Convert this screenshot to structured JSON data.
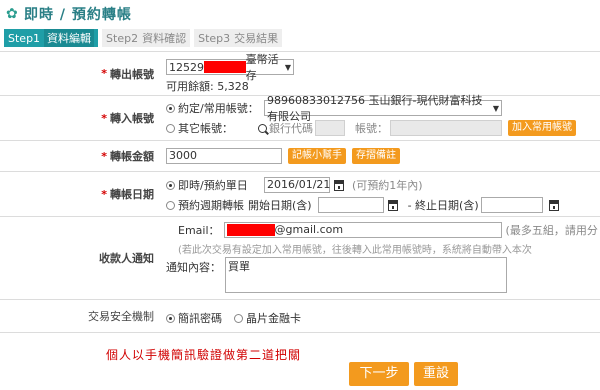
{
  "header": {
    "title": "即時 / 預約轉帳"
  },
  "steps": [
    {
      "num": "Step1",
      "label": "資料編輯"
    },
    {
      "num": "Step2",
      "label": "資料確認"
    },
    {
      "num": "Step3",
      "label": "交易結果"
    }
  ],
  "from_account": {
    "label": "轉出帳號",
    "prefix": "12529",
    "suffix": "臺幣活存",
    "available_label": "可用餘額:",
    "available_value": "5,328"
  },
  "to_account": {
    "label": "轉入帳號",
    "option_agreed": "約定/常用帳號：",
    "agreed_selected": "98960833012756 玉山銀行-現代財富科技有限公司",
    "option_other": "其它帳號：",
    "bank_code_placeholder": "銀行代碼",
    "account_label": "帳號：",
    "add_button": "加入常用帳號"
  },
  "amount": {
    "label": "轉帳金額",
    "value": "3000",
    "notebook_button": "記帳小幫手",
    "memo_button": "存摺備註"
  },
  "date": {
    "label": "轉帳日期",
    "option_single": "即時/預約單日",
    "single_date": "2016/01/21",
    "single_hint": "(可預約1年內)",
    "option_periodic": "預約週期轉帳",
    "start_label": "開始日期(含)",
    "end_label": "- 終止日期(含)"
  },
  "notify": {
    "label": "收款人通知",
    "email_label": "Email：",
    "email_domain": "@gmail.com",
    "email_hint": "(最多五組，請用分",
    "info": "(若此次交易有設定加入常用帳號，往後轉入此常用帳號時，系統將自動帶入本次",
    "content_label": "通知內容：",
    "content_value": "買單"
  },
  "security": {
    "label": "交易安全機制",
    "option_sms": "簡訊密碼",
    "option_card": "晶片金融卡"
  },
  "warning": "個人以手機簡訊驗證做第二道把關",
  "buttons": {
    "next": "下一步",
    "reset": "重設"
  }
}
